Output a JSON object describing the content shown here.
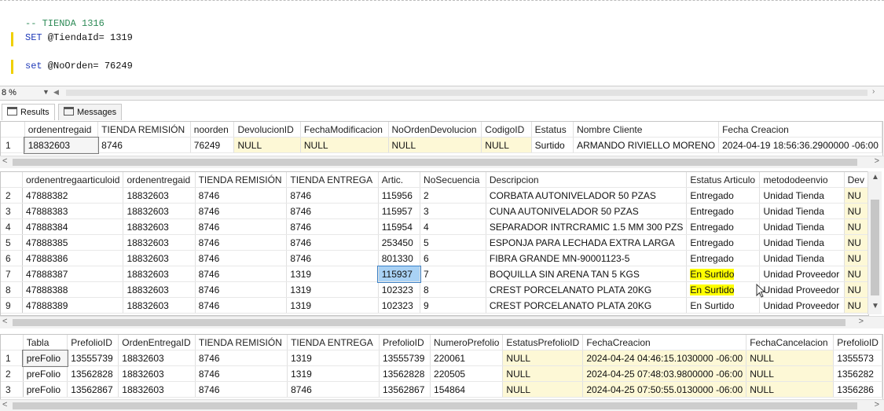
{
  "editor": {
    "lines": [
      {
        "comment": "-- TIENDA 1316"
      },
      {
        "kw": "SET",
        "rest": " @TiendaId= ",
        "num": "1319"
      },
      {
        "kw": "set",
        "rest": " @NoOrden= ",
        "num": "76249"
      }
    ]
  },
  "zoom": {
    "value": "8 %"
  },
  "tabs": {
    "results": "Results",
    "messages": "Messages"
  },
  "grid1": {
    "columns": [
      "ordenentregaid",
      "TIENDA REMISIÓN",
      "noorden",
      "DevolucionID",
      "FechaModificacion",
      "NoOrdenDevolucion",
      "CodigoID",
      "Estatus",
      "Nombre Cliente",
      "Fecha Creacion"
    ],
    "rows": [
      {
        "rn": "1",
        "cells": [
          "18832603",
          "8746",
          "76249",
          "NULL",
          "NULL",
          "NULL",
          "NULL",
          "Surtido",
          "ARMANDO RIVIELLO MORENO",
          "2024-04-19 18:56:36.2900000 -06:00"
        ]
      }
    ]
  },
  "grid2": {
    "columns": [
      "ordenentregaarticuloid",
      "ordenentregaid",
      "TIENDA REMISIÓN",
      "TIENDA ENTREGA",
      "Artic.",
      "NoSecuencia",
      "Descripcion",
      "Estatus Articulo",
      "metododeenvio",
      "Dev"
    ],
    "rows": [
      {
        "rn": "2",
        "cells": [
          "47888382",
          "18832603",
          "8746",
          "8746",
          "115956",
          "2",
          "CORBATA AUTONIVELADOR 50 PZAS",
          "Entregado",
          "Unidad Tienda",
          "NU"
        ]
      },
      {
        "rn": "3",
        "cells": [
          "47888383",
          "18832603",
          "8746",
          "8746",
          "115957",
          "3",
          "CUNA AUTONIVELADOR 50 PZAS",
          "Entregado",
          "Unidad Tienda",
          "NU"
        ]
      },
      {
        "rn": "4",
        "cells": [
          "47888384",
          "18832603",
          "8746",
          "8746",
          "115954",
          "4",
          "SEPARADOR INTRCRAMIC 1.5 MM 300 PZS",
          "Entregado",
          "Unidad Tienda",
          "NU"
        ]
      },
      {
        "rn": "5",
        "cells": [
          "47888385",
          "18832603",
          "8746",
          "8746",
          "253450",
          "5",
          "ESPONJA PARA LECHADA EXTRA LARGA",
          "Entregado",
          "Unidad Tienda",
          "NU"
        ]
      },
      {
        "rn": "6",
        "cells": [
          "47888386",
          "18832603",
          "8746",
          "8746",
          "801330",
          "6",
          "FIBRA GRANDE MN-90001123-5",
          "Entregado",
          "Unidad Tienda",
          "NU"
        ]
      },
      {
        "rn": "7",
        "cells": [
          "47888387",
          "18832603",
          "8746",
          "1319",
          "115937",
          "7",
          "BOQUILLA SIN ARENA TAN 5 KGS",
          "En Surtido",
          "Unidad Proveedor",
          "NU"
        ]
      },
      {
        "rn": "8",
        "cells": [
          "47888388",
          "18832603",
          "8746",
          "1319",
          "102323",
          "8",
          "CREST PORCELANATO PLATA 20KG",
          "En Surtido",
          "Unidad Proveedor",
          "NU"
        ]
      },
      {
        "rn": "9",
        "cells": [
          "47888389",
          "18832603",
          "8746",
          "1319",
          "102323",
          "9",
          "CREST PORCELANATO PLATA 20KG",
          "En Surtido",
          "Unidad Proveedor",
          "NU"
        ]
      }
    ]
  },
  "grid3": {
    "columns": [
      "Tabla",
      "PrefolioID",
      "OrdenEntregaID",
      "TIENDA REMISIÓN",
      "TIENDA ENTREGA",
      "PrefolioID",
      "NumeroPrefolio",
      "EstatusPrefolioID",
      "FechaCreacion",
      "FechaCancelacion",
      "PrefolioID"
    ],
    "rows": [
      {
        "rn": "1",
        "cells": [
          "preFolio",
          "13555739",
          "18832603",
          "8746",
          "1319",
          "13555739",
          "220061",
          "NULL",
          "2024-04-24 04:46:15.1030000 -06:00",
          "NULL",
          "1355573"
        ]
      },
      {
        "rn": "2",
        "cells": [
          "preFolio",
          "13562828",
          "18832603",
          "8746",
          "1319",
          "13562828",
          "220505",
          "NULL",
          "2024-04-25 07:48:03.9800000 -06:00",
          "NULL",
          "1356282"
        ]
      },
      {
        "rn": "3",
        "cells": [
          "preFolio",
          "13562867",
          "18832603",
          "8746",
          "8746",
          "13562867",
          "154864",
          "NULL",
          "2024-04-25 07:50:55.0130000 -06:00",
          "NULL",
          "1356286"
        ]
      }
    ]
  },
  "colors": {
    "null_bg": "#fdf8d6",
    "highlight": "#ffff00",
    "selection": "#a9d2f5",
    "keyword": "#1f3ab8",
    "comment": "#2e8b57"
  }
}
